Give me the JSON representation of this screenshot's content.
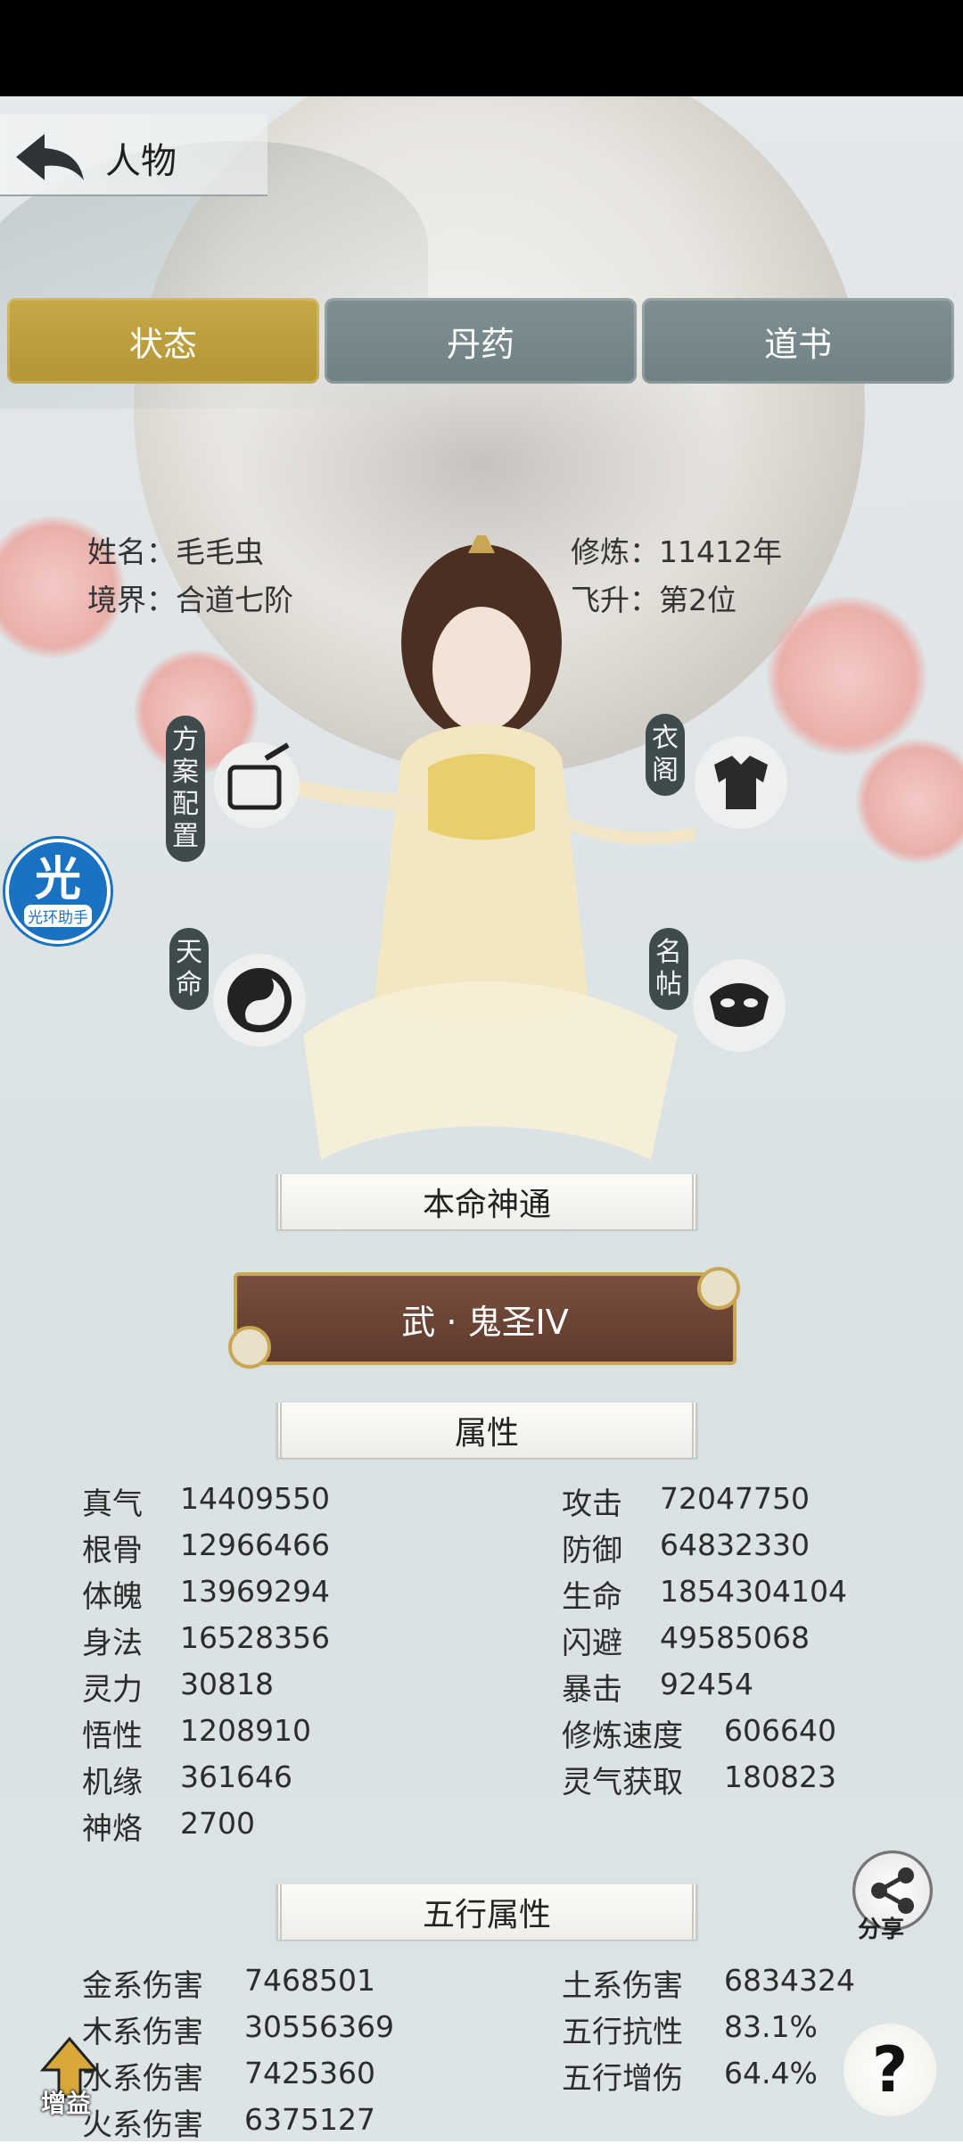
{
  "header": {
    "title": "人物"
  },
  "tabs": [
    {
      "label": "状态",
      "active": true
    },
    {
      "label": "丹药",
      "active": false
    },
    {
      "label": "道书",
      "active": false
    }
  ],
  "character": {
    "name_line": "姓名：毛毛虫",
    "realm_line": "境界：合道七阶",
    "cultivation_line": "修炼：11412年",
    "ascension_line": "飞升：第2位"
  },
  "side_buttons": {
    "scheme": "方案配置",
    "wardrobe": "衣阁",
    "destiny": "天命",
    "card": "名帖"
  },
  "halo_assistant": {
    "big": "光",
    "small": "光环助手"
  },
  "innate_skill": {
    "heading": "本命神通",
    "name": "武 · 鬼圣IV"
  },
  "attributes": {
    "heading": "属性",
    "left": [
      {
        "label": "真气",
        "value": "14409550"
      },
      {
        "label": "根骨",
        "value": "12966466"
      },
      {
        "label": "体魄",
        "value": "13969294"
      },
      {
        "label": "身法",
        "value": "16528356"
      },
      {
        "label": "灵力",
        "value": "30818"
      },
      {
        "label": "悟性",
        "value": "1208910"
      },
      {
        "label": "机缘",
        "value": "361646"
      },
      {
        "label": "神烙",
        "value": "2700"
      }
    ],
    "right": [
      {
        "label": "攻击",
        "value": "72047750"
      },
      {
        "label": "防御",
        "value": "64832330"
      },
      {
        "label": "生命",
        "value": "1854304104"
      },
      {
        "label": "闪避",
        "value": "49585068"
      },
      {
        "label": "暴击",
        "value": "92454"
      },
      {
        "label": "修炼速度",
        "value": "606640"
      },
      {
        "label": "灵气获取",
        "value": "180823"
      }
    ]
  },
  "five_elements": {
    "heading": "五行属性",
    "left": [
      {
        "label": "金系伤害",
        "value": "7468501"
      },
      {
        "label": "木系伤害",
        "value": "30556369"
      },
      {
        "label": "水系伤害",
        "value": "7425360"
      },
      {
        "label": "火系伤害",
        "value": "6375127"
      }
    ],
    "right": [
      {
        "label": "土系伤害",
        "value": "6834324"
      },
      {
        "label": "五行抗性",
        "value": "83.1%"
      },
      {
        "label": "五行增伤",
        "value": "64.4%"
      }
    ]
  },
  "share": {
    "label": "分享"
  },
  "help": {
    "glyph": "?"
  },
  "boost": {
    "label": "增益"
  },
  "colors": {
    "active_tab": "#c6a847",
    "inactive_tab": "#7f9094",
    "skill_bg": "#6a4435",
    "halo": "#1c72c2"
  }
}
